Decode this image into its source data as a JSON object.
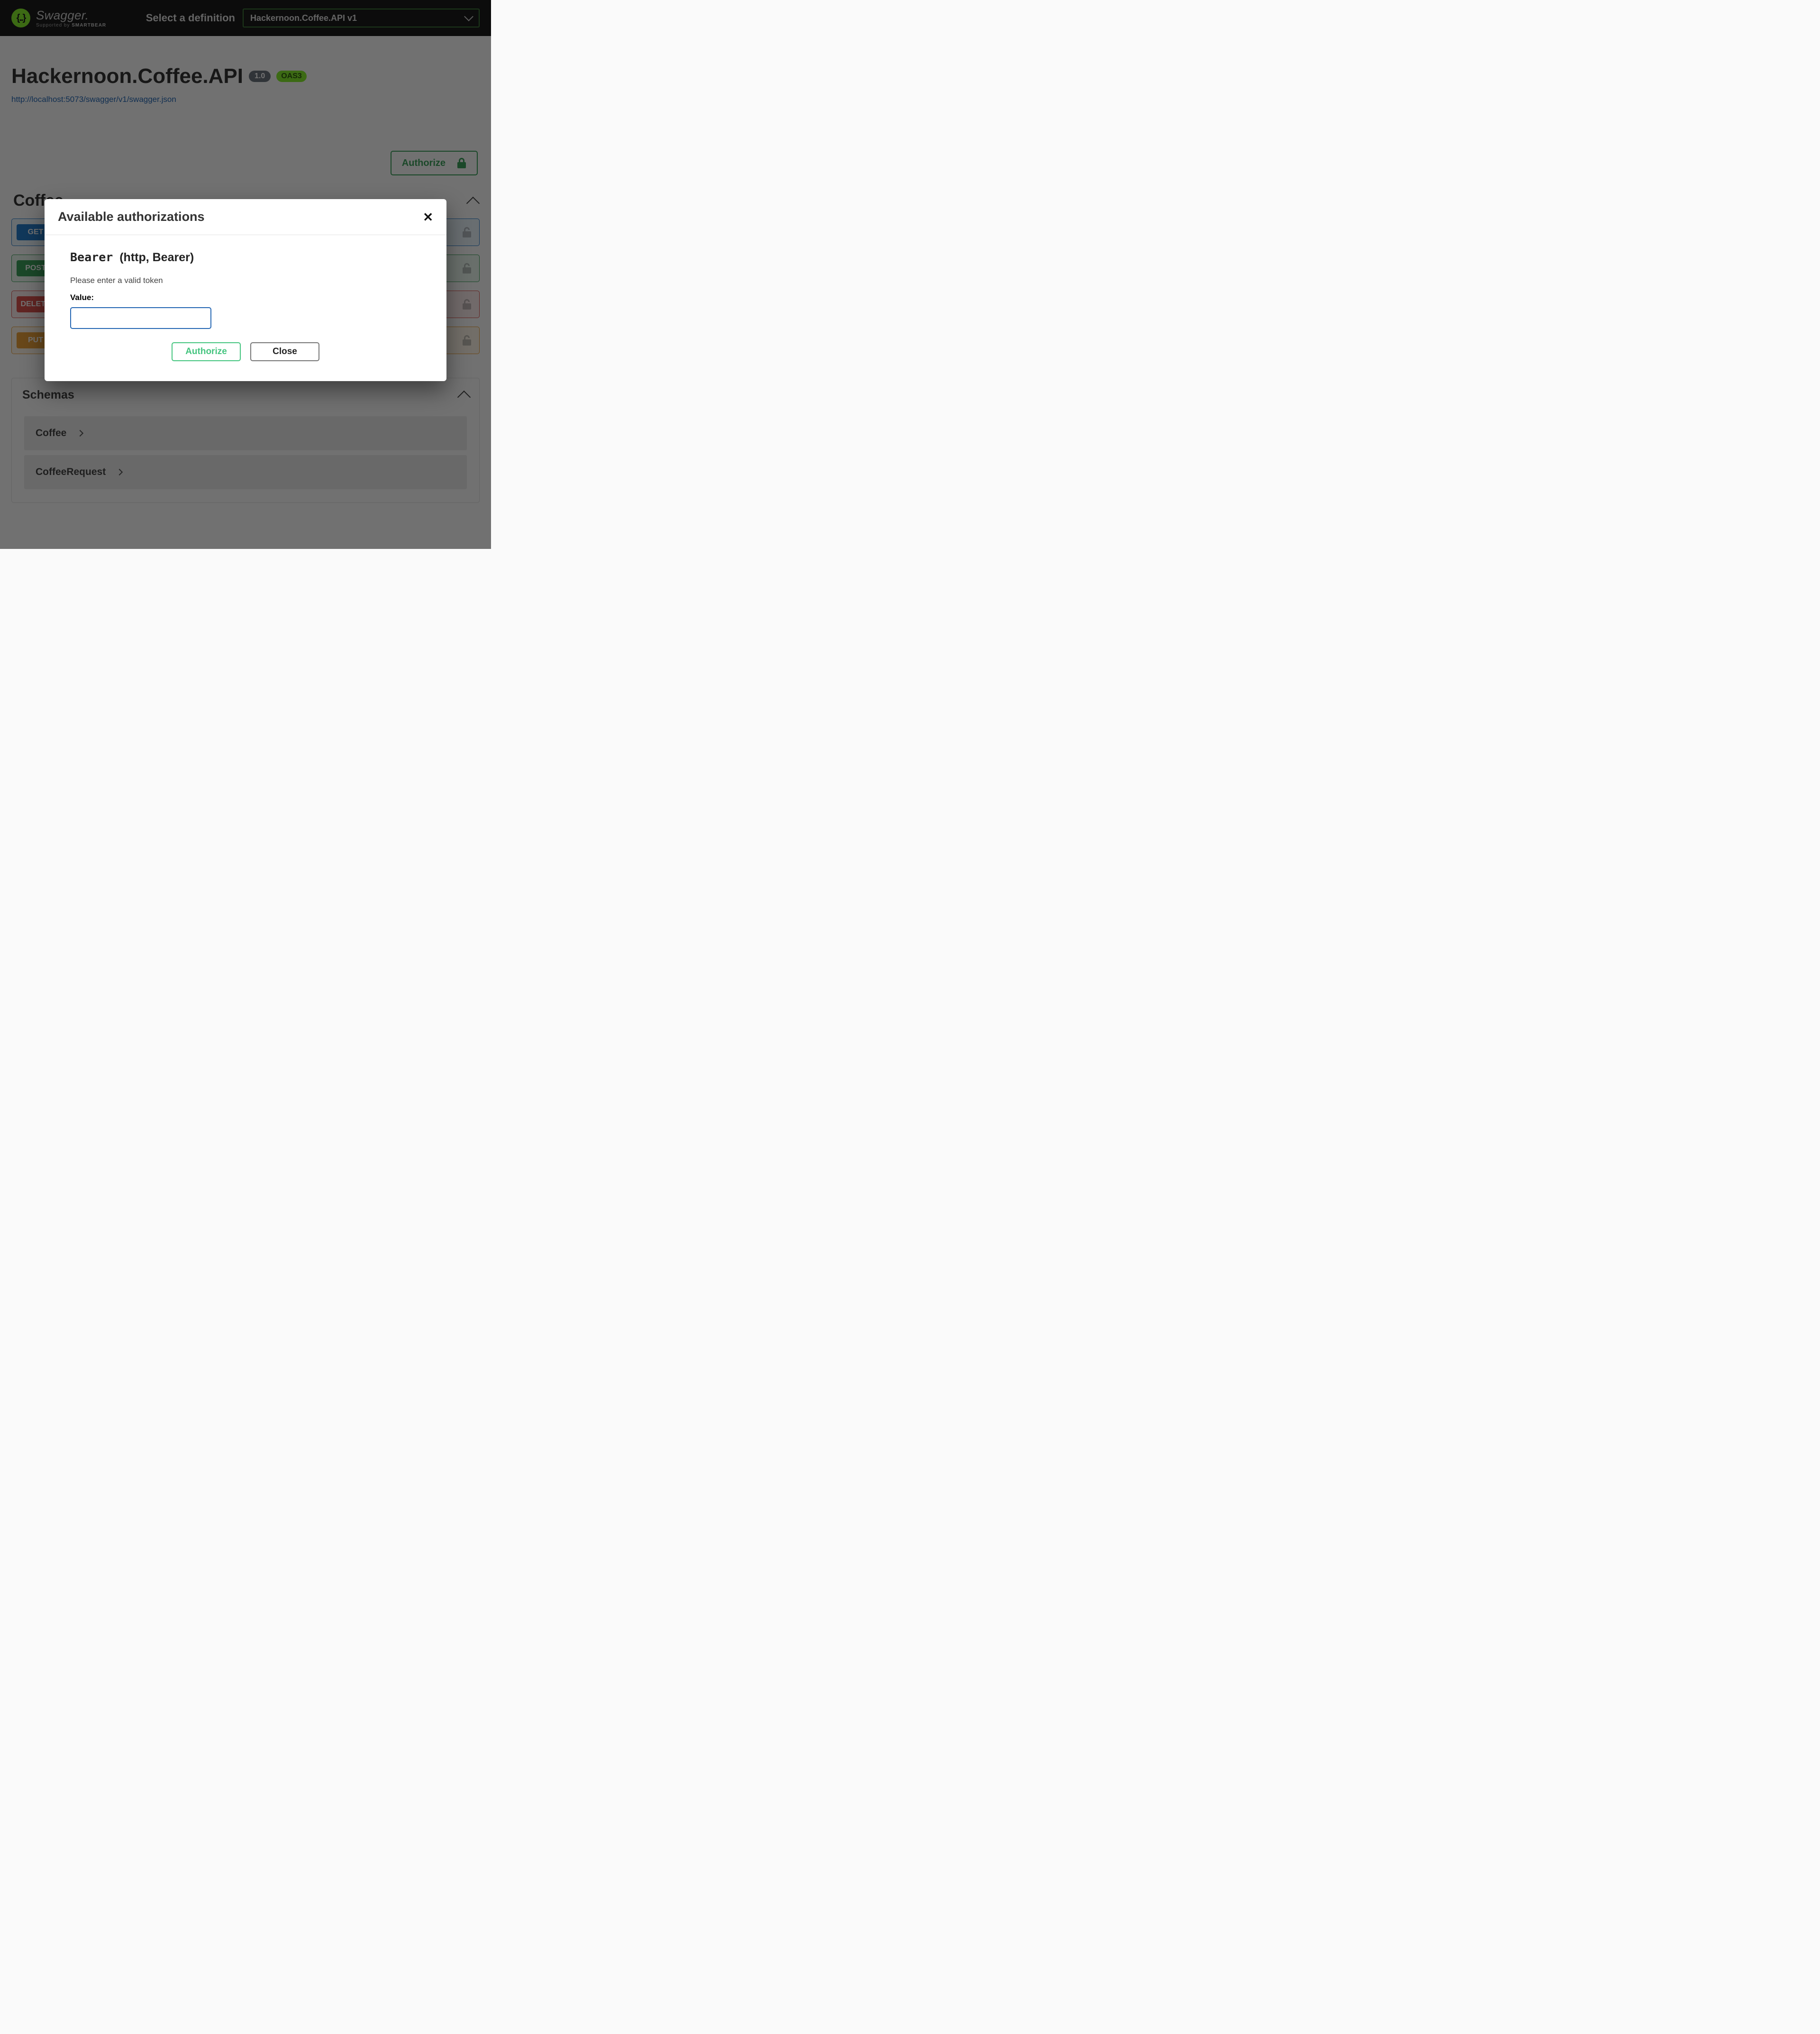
{
  "header": {
    "select_label": "Select a definition",
    "selected_definition": "Hackernoon.Coffee.API v1",
    "logo_main": "Swagger.",
    "logo_sub_prefix": "Supported by ",
    "logo_sub_brand": "SMARTBEAR"
  },
  "api": {
    "title": "Hackernoon.Coffee.API",
    "version": "1.0",
    "oas": "OAS3",
    "spec_url": "http://localhost:5073/swagger/v1/swagger.json"
  },
  "authorize_button": "Authorize",
  "tag": {
    "name": "Coffee"
  },
  "endpoints": [
    {
      "method": "GET"
    },
    {
      "method": "POST"
    },
    {
      "method": "DELETE"
    },
    {
      "method": "PUT"
    }
  ],
  "schemas": {
    "title": "Schemas",
    "items": [
      "Coffee",
      "CoffeeRequest"
    ]
  },
  "modal": {
    "title": "Available authorizations",
    "scheme_name": "Bearer",
    "scheme_type": "(http, Bearer)",
    "description": "Please enter a valid token",
    "value_label": "Value:",
    "value": "",
    "authorize": "Authorize",
    "close": "Close"
  }
}
